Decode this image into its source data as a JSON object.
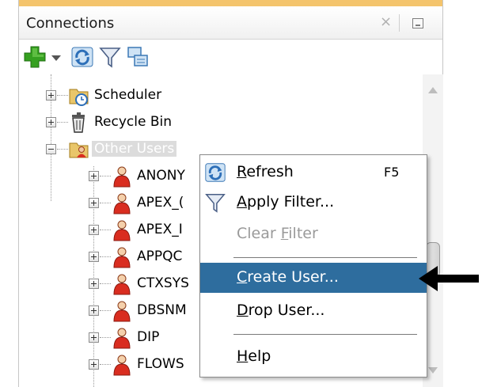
{
  "panel": {
    "title": "Connections",
    "close_glyph": "×"
  },
  "toolbar": {
    "buttons": [
      {
        "icon": "add-connection-icon"
      },
      {
        "icon": "dropdown-arrow-icon"
      },
      {
        "icon": "refresh-icon"
      },
      {
        "icon": "filter-icon"
      },
      {
        "icon": "schema-browser-icon"
      }
    ]
  },
  "tree": {
    "items": [
      {
        "label": "Scheduler",
        "icon": "scheduler-icon",
        "expanded": false
      },
      {
        "label": "Recycle Bin",
        "icon": "recycle-bin-icon",
        "expanded": false
      },
      {
        "label": "Other Users",
        "icon": "other-users-folder-icon",
        "expanded": true,
        "selected": true
      },
      {
        "label": "ANONY",
        "icon": "user-icon"
      },
      {
        "label": "APEX_(",
        "icon": "user-icon"
      },
      {
        "label": "APEX_I",
        "icon": "user-icon"
      },
      {
        "label": "APPQC",
        "icon": "user-icon"
      },
      {
        "label": "CTXSYS",
        "icon": "user-icon"
      },
      {
        "label": "DBSNM",
        "icon": "user-icon"
      },
      {
        "label": "DIP",
        "icon": "user-icon"
      },
      {
        "label": "FLOWS",
        "icon": "user-icon"
      }
    ]
  },
  "context_menu": {
    "items": [
      {
        "pre": "",
        "mnemonic": "R",
        "post": "efresh",
        "shortcut": "F5",
        "icon": "refresh-icon"
      },
      {
        "pre": "",
        "mnemonic": "A",
        "post": "pply Filter...",
        "shortcut": "",
        "icon": "filter-icon"
      },
      {
        "pre": "Clear ",
        "mnemonic": "F",
        "post": "ilter",
        "shortcut": "",
        "disabled": true
      },
      {
        "pre": "",
        "mnemonic": "C",
        "post": "reate User...",
        "shortcut": "",
        "highlighted": true
      },
      {
        "pre": "",
        "mnemonic": "D",
        "post": "rop User...",
        "shortcut": ""
      },
      {
        "pre": "",
        "mnemonic": "H",
        "post": "elp",
        "shortcut": ""
      }
    ]
  },
  "colors": {
    "accent": "#f4c46c",
    "menu_highlight": "#2e6d9e",
    "selection": "#dcdcdc",
    "add_green": "#35a020",
    "user_red": "#d92d20"
  }
}
